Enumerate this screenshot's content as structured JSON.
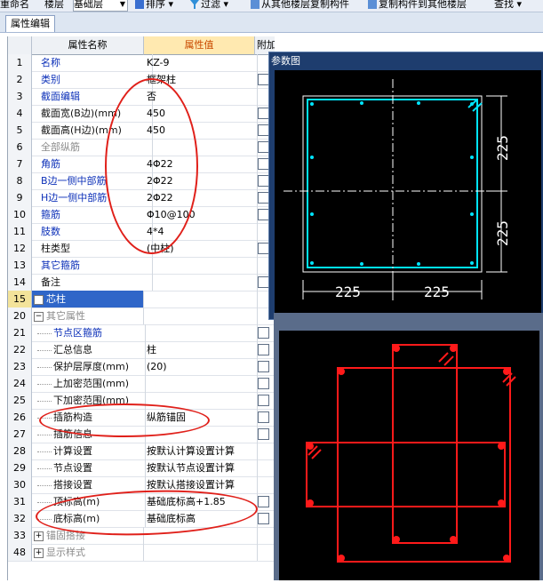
{
  "toolbar": {
    "items": [
      "重命名",
      "楼层",
      "基础层",
      "排序",
      "过滤",
      "从其他楼层复制构件",
      "复制构件到其他楼层",
      "查找"
    ]
  },
  "tab": {
    "label": "属性编辑"
  },
  "grid": {
    "headers": {
      "name": "属性名称",
      "value": "属性值",
      "attach": "附加"
    },
    "rows": [
      {
        "num": "1",
        "name": "名称",
        "value": "KZ-9"
      },
      {
        "num": "2",
        "name": "类别",
        "value": "框架柱"
      },
      {
        "num": "3",
        "name": "截面编辑",
        "value": "否"
      },
      {
        "num": "4",
        "name": "截面宽(B边)(mm)",
        "value": "450"
      },
      {
        "num": "5",
        "name": "截面高(H边)(mm)",
        "value": "450"
      },
      {
        "num": "6",
        "name": "全部纵筋",
        "value": ""
      },
      {
        "num": "7",
        "name": "角筋",
        "value": "4Φ22"
      },
      {
        "num": "8",
        "name": "B边一侧中部筋",
        "value": "2Φ22"
      },
      {
        "num": "9",
        "name": "H边一侧中部筋",
        "value": "2Φ22"
      },
      {
        "num": "10",
        "name": "箍筋",
        "value": "Φ10@100"
      },
      {
        "num": "11",
        "name": "肢数",
        "value": "4*4"
      },
      {
        "num": "12",
        "name": "柱类型",
        "value": "(中柱)"
      },
      {
        "num": "13",
        "name": "其它箍筋",
        "value": ""
      },
      {
        "num": "14",
        "name": "备注",
        "value": ""
      },
      {
        "num": "15",
        "name": "芯柱",
        "value": ""
      },
      {
        "num": "20",
        "name": "其它属性",
        "value": ""
      },
      {
        "num": "21",
        "name": "节点区箍筋",
        "value": ""
      },
      {
        "num": "22",
        "name": "汇总信息",
        "value": "柱"
      },
      {
        "num": "23",
        "name": "保护层厚度(mm)",
        "value": "(20)"
      },
      {
        "num": "24",
        "name": "上加密范围(mm)",
        "value": ""
      },
      {
        "num": "25",
        "name": "下加密范围(mm)",
        "value": ""
      },
      {
        "num": "26",
        "name": "插筋构造",
        "value": "纵筋锚固"
      },
      {
        "num": "27",
        "name": "插筋信息",
        "value": ""
      },
      {
        "num": "28",
        "name": "计算设置",
        "value": "按默认计算设置计算"
      },
      {
        "num": "29",
        "name": "节点设置",
        "value": "按默认节点设置计算"
      },
      {
        "num": "30",
        "name": "搭接设置",
        "value": "按默认搭接设置计算"
      },
      {
        "num": "31",
        "name": "顶标高(m)",
        "value": "基础底标高+1.85"
      },
      {
        "num": "32",
        "name": "底标高(m)",
        "value": "基础底标高"
      },
      {
        "num": "33",
        "name": "锚固搭接",
        "value": ""
      },
      {
        "num": "48",
        "name": "显示样式",
        "value": ""
      }
    ]
  },
  "param_panel": {
    "title": "参数图",
    "dims": {
      "right_top": "225",
      "right_bottom": "225",
      "bottom_left": "225",
      "bottom_right": "225"
    }
  },
  "colors": {
    "cyan": "#00e5ff",
    "red": "#ff1a1a",
    "annotation": "#e0201a"
  }
}
